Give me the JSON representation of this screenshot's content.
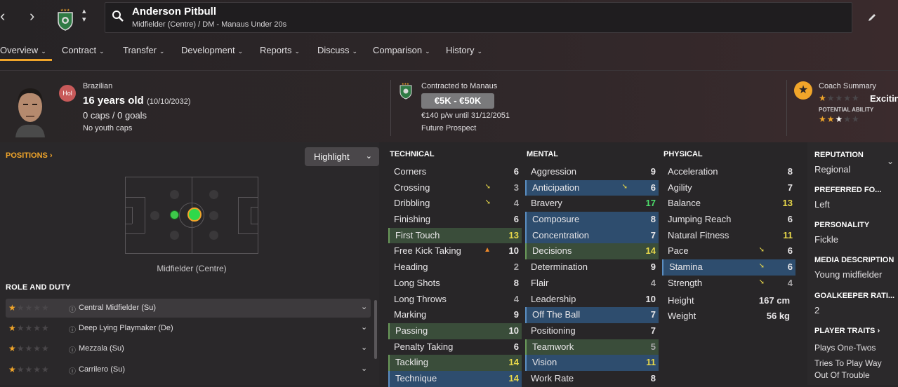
{
  "header": {
    "player_name": "Anderson Pitbull",
    "player_subtitle": "Midfielder (Centre) / DM - Manaus Under 20s"
  },
  "tabs": [
    {
      "label": "Overview"
    },
    {
      "label": "Contract"
    },
    {
      "label": "Transfer"
    },
    {
      "label": "Development"
    },
    {
      "label": "Reports"
    },
    {
      "label": "Discuss"
    },
    {
      "label": "Comparison"
    },
    {
      "label": "History"
    }
  ],
  "bio": {
    "nationality": "Brazilian",
    "badge": "Hol",
    "age": "16 years old",
    "dob": "(10/10/2032)",
    "caps": "0 caps / 0 goals",
    "youth": "No youth caps"
  },
  "contract": {
    "club": "Contracted to Manaus",
    "value": "€5K - €50K",
    "wage": "€140 p/w until 31/12/2051",
    "status": "Future Prospect"
  },
  "coach": {
    "title": "Coach Summary",
    "verdict": "Excitin",
    "potential_label": "POTENTIAL ABILITY",
    "current_stars": 1,
    "potential_stars": 3
  },
  "positions": {
    "header": "POSITIONS",
    "highlight_label": "Highlight",
    "position_name": "Midfielder (Centre)"
  },
  "roles": {
    "header": "ROLE AND DUTY",
    "items": [
      {
        "name": "Central Midfielder (Su)",
        "stars": 1
      },
      {
        "name": "Deep Lying Playmaker (De)",
        "stars": 1
      },
      {
        "name": "Mezzala (Su)",
        "stars": 1
      },
      {
        "name": "Carrilero (Su)",
        "stars": 1
      }
    ]
  },
  "technical": {
    "header": "TECHNICAL",
    "items": [
      {
        "name": "Corners",
        "value": "6"
      },
      {
        "name": "Crossing",
        "value": "3"
      },
      {
        "name": "Dribbling",
        "value": "4"
      },
      {
        "name": "Finishing",
        "value": "6"
      },
      {
        "name": "First Touch",
        "value": "13"
      },
      {
        "name": "Free Kick Taking",
        "value": "10"
      },
      {
        "name": "Heading",
        "value": "2"
      },
      {
        "name": "Long Shots",
        "value": "8"
      },
      {
        "name": "Long Throws",
        "value": "4"
      },
      {
        "name": "Marking",
        "value": "9"
      },
      {
        "name": "Passing",
        "value": "10"
      },
      {
        "name": "Penalty Taking",
        "value": "6"
      },
      {
        "name": "Tackling",
        "value": "14"
      },
      {
        "name": "Technique",
        "value": "14"
      }
    ]
  },
  "mental": {
    "header": "MENTAL",
    "items": [
      {
        "name": "Aggression",
        "value": "9"
      },
      {
        "name": "Anticipation",
        "value": "6"
      },
      {
        "name": "Bravery",
        "value": "17"
      },
      {
        "name": "Composure",
        "value": "8"
      },
      {
        "name": "Concentration",
        "value": "7"
      },
      {
        "name": "Decisions",
        "value": "14"
      },
      {
        "name": "Determination",
        "value": "9"
      },
      {
        "name": "Flair",
        "value": "4"
      },
      {
        "name": "Leadership",
        "value": "10"
      },
      {
        "name": "Off The Ball",
        "value": "7"
      },
      {
        "name": "Positioning",
        "value": "7"
      },
      {
        "name": "Teamwork",
        "value": "5"
      },
      {
        "name": "Vision",
        "value": "11"
      },
      {
        "name": "Work Rate",
        "value": "8"
      }
    ]
  },
  "physical": {
    "header": "PHYSICAL",
    "items": [
      {
        "name": "Acceleration",
        "value": "8"
      },
      {
        "name": "Agility",
        "value": "7"
      },
      {
        "name": "Balance",
        "value": "13"
      },
      {
        "name": "Jumping Reach",
        "value": "6"
      },
      {
        "name": "Natural Fitness",
        "value": "11"
      },
      {
        "name": "Pace",
        "value": "6"
      },
      {
        "name": "Stamina",
        "value": "6"
      },
      {
        "name": "Strength",
        "value": "4"
      },
      {
        "name": "Height",
        "value": "167 cm"
      },
      {
        "name": "Weight",
        "value": "56 kg"
      }
    ]
  },
  "side": {
    "reputation_h": "REPUTATION",
    "reputation_v": "Regional",
    "foot_h": "PREFERRED FO...",
    "foot_v": "Left",
    "personality_h": "PERSONALITY",
    "personality_v": "Fickle",
    "media_h": "MEDIA DESCRIPTION",
    "media_v": "Young midfielder",
    "gk_h": "GOALKEEPER RATI...",
    "gk_v": "2",
    "traits_h": "PLAYER TRAITS",
    "traits": [
      "Plays One-Twos",
      "Tries To Play Way",
      "Out Of Trouble"
    ]
  },
  "colors": {
    "accent": "#f0a52a",
    "highlight_blue": "#2e4d6e",
    "highlight_green": "#3a4d3a",
    "value_green": "#4ddc6a",
    "value_yellow": "#e8d84a"
  }
}
